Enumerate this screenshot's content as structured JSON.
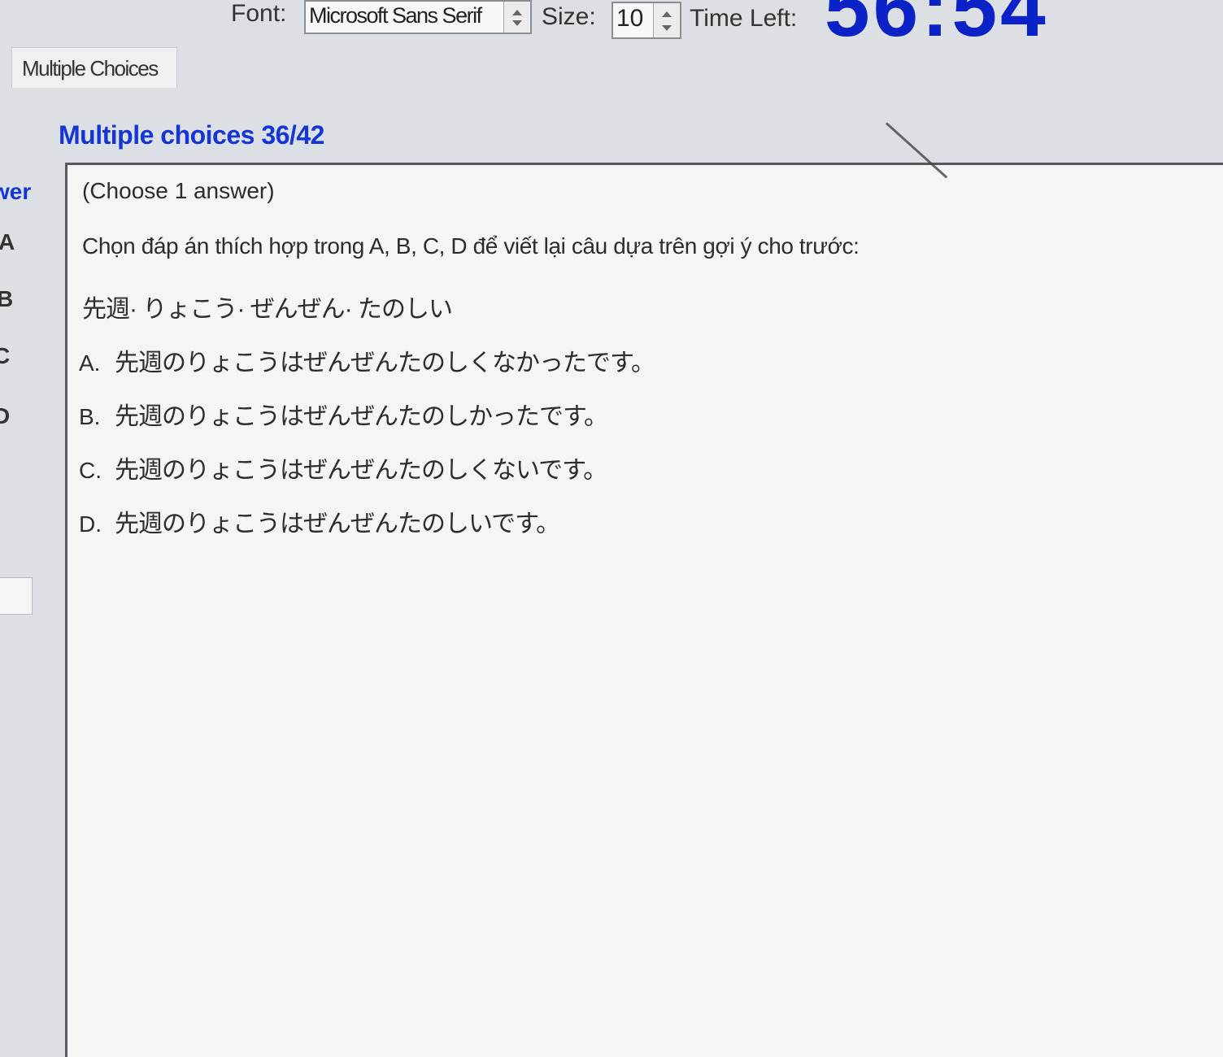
{
  "toolbar": {
    "font_label": "Font:",
    "font_value": "Microsoft Sans Serif",
    "size_label": "Size:",
    "size_value": "10",
    "time_left_label": "Time Left:",
    "time_left_value": "56:54"
  },
  "tabs": [
    {
      "label": "Multiple Choices"
    }
  ],
  "section": {
    "title": "Multiple choices 36/42"
  },
  "sidebar": {
    "answer_label": "wer",
    "options": [
      "A",
      "B",
      "C",
      "D"
    ]
  },
  "question": {
    "instruction": "(Choose 1 answer)",
    "prompt": "Chọn đáp án thích hợp trong A, B, C, D để viết lại câu dựa trên gợi ý cho trước:",
    "sentence": "先週· りょこう· ぜんぜん· たのしい",
    "options": [
      {
        "letter": "A.",
        "text": "先週のりょこうはぜんぜんたのしくなかったです。"
      },
      {
        "letter": "B.",
        "text": "先週のりょこうはぜんぜんたのしかったです。"
      },
      {
        "letter": "C.",
        "text": "先週のりょこうはぜんぜんたのしくないです。"
      },
      {
        "letter": "D.",
        "text": "先週のりょこうはぜんぜんたのしいです。"
      }
    ]
  },
  "colors": {
    "timer": "#0a22c6",
    "section_title": "#1436d4",
    "background": "#dcdfe3",
    "panel": "#f4f5f5"
  }
}
